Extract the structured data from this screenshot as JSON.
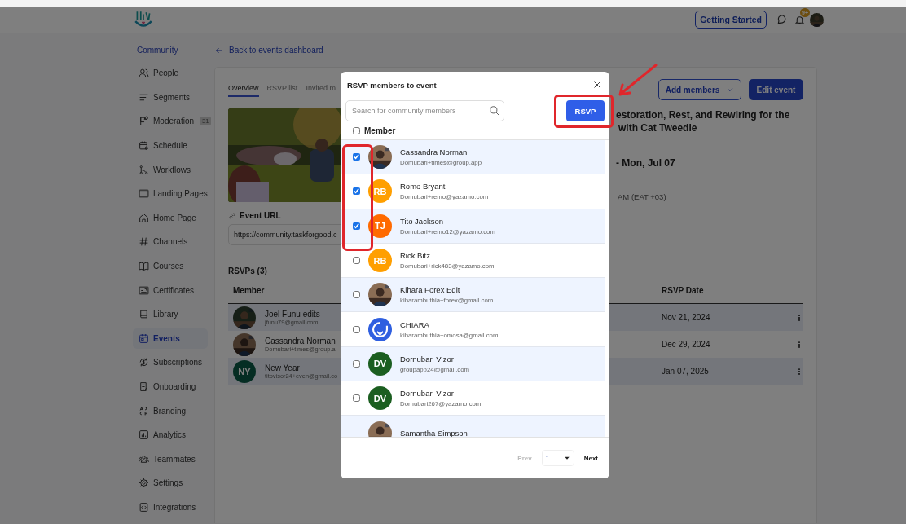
{
  "header": {
    "getting_started": "Getting Started",
    "notification_badge": "9+"
  },
  "sidebar": {
    "section": "Community",
    "items": [
      {
        "label": "People",
        "selected": false
      },
      {
        "label": "Segments",
        "selected": false
      },
      {
        "label": "Moderation",
        "selected": false,
        "badge": "31"
      },
      {
        "label": "Schedule",
        "selected": false
      },
      {
        "label": "Workflows",
        "selected": false
      },
      {
        "label": "Landing Pages",
        "selected": false
      },
      {
        "label": "Home Page",
        "selected": false
      },
      {
        "label": "Channels",
        "selected": false
      },
      {
        "label": "Courses",
        "selected": false
      },
      {
        "label": "Certificates",
        "selected": false
      },
      {
        "label": "Library",
        "selected": false
      },
      {
        "label": "Events",
        "selected": true
      },
      {
        "label": "Subscriptions",
        "selected": false
      },
      {
        "label": "Onboarding",
        "selected": false
      },
      {
        "label": "Branding",
        "selected": false
      },
      {
        "label": "Analytics",
        "selected": false
      },
      {
        "label": "Teammates",
        "selected": false
      },
      {
        "label": "Settings",
        "selected": false
      },
      {
        "label": "Integrations",
        "selected": false
      }
    ]
  },
  "page": {
    "back_link": "Back to events dashboard",
    "tabs": [
      {
        "label": "Overview",
        "selected": true
      },
      {
        "label": "RSVP list",
        "selected": false
      },
      {
        "label": "Invited m",
        "selected": false
      }
    ],
    "add_members": "Add members",
    "edit_event": "Edit event",
    "title_lines": [
      "estoration, Rest, and Rewiring for the",
      "with Cat Tweedie"
    ],
    "date_lines": [
      "- Mon, Jul 07",
      "AM (EAT +03)"
    ],
    "event_url_label": "Event URL",
    "event_url": "https://community.taskforgood.c",
    "rsvps": {
      "title": "RSVPs (3)",
      "columns": [
        "Member",
        "RSVP Date"
      ],
      "rows": [
        {
          "name": "Joel Funu edits",
          "email": "jfunu79@gmail.com",
          "date": "Nov 21, 2024"
        },
        {
          "name": "Cassandra Norman",
          "email": "Domubari+times@group.a",
          "date": "Dec 29, 2024"
        },
        {
          "name": "New Year",
          "email": "titovisor24+even@gmail.co",
          "date": "Jan 07, 2025",
          "avatar": {
            "kind": "initials",
            "initials": "NY"
          }
        }
      ]
    }
  },
  "modal": {
    "title": "RSVP members to event",
    "search_placeholder": "Search for community members",
    "rsvp_button": "RSVP",
    "column": "Member",
    "select_all": false,
    "members": [
      {
        "name": "Cassandra Norman",
        "email": "Domubari+times@group.app",
        "checked": true
      },
      {
        "name": "Romo Bryant",
        "email": "Domubari+remo@yazamo.com",
        "checked": true,
        "avatar": {
          "kind": "initials",
          "initials": "RB",
          "color": "#ff9f00"
        }
      },
      {
        "name": "Tito Jackson",
        "email": "Domubari+remo12@yazamo.com",
        "checked": true,
        "avatar": {
          "kind": "initials",
          "initials": "TJ",
          "color": "#ff6a00"
        }
      },
      {
        "name": "Rick Bitz",
        "email": "Domubari+rick483@yazamo.com",
        "checked": false,
        "avatar": {
          "kind": "initials",
          "initials": "RB",
          "color": "#ff9f00"
        }
      },
      {
        "name": "Kihara Forex Edit",
        "email": "kiharambuthia+forex@gmail.com",
        "checked": false
      },
      {
        "name": "CHIARA",
        "email": "kiharambuthia+omosa@gmail.com",
        "checked": false,
        "avatar": {
          "kind": "logo"
        }
      },
      {
        "name": "Dornubari Vizor",
        "email": "groupapp24@gmail.com",
        "checked": false,
        "avatar": {
          "kind": "initials",
          "initials": "DV",
          "color": "#1b5e20"
        }
      },
      {
        "name": "Dornubari Vizor",
        "email": "Dornubari267@yazamo.com",
        "checked": false,
        "avatar": {
          "kind": "initials",
          "initials": "DV",
          "color": "#1b5e20"
        }
      },
      {
        "name": "Samantha Simpson"
      }
    ],
    "pagination": {
      "prev": "Prev",
      "prev_disabled": true,
      "page": "1",
      "next": "Next"
    }
  },
  "annotations": [
    {
      "kind": "checkbox-outline"
    },
    {
      "kind": "button-outline"
    },
    {
      "kind": "arrow"
    }
  ]
}
